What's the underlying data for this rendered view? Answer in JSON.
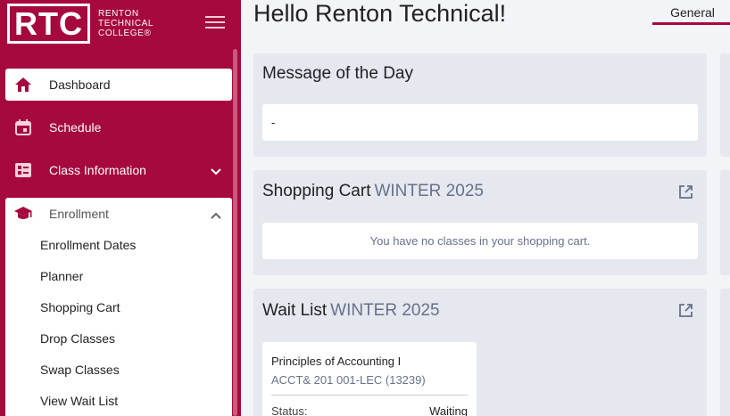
{
  "logo": {
    "abbr": "RTC",
    "line1": "RENTON",
    "line2": "TECHNICAL",
    "line3": "COLLEGE®"
  },
  "sidebar": {
    "items": [
      {
        "label": "Dashboard",
        "icon": "home-icon"
      },
      {
        "label": "Schedule",
        "icon": "calendar-icon"
      },
      {
        "label": "Class Information",
        "icon": "class-info-icon"
      }
    ],
    "enrollment": {
      "label": "Enrollment",
      "icon": "graduation-cap-icon",
      "subitems": [
        "Enrollment Dates",
        "Planner",
        "Shopping Cart",
        "Drop Classes",
        "Swap Classes",
        "View Wait List"
      ]
    }
  },
  "header": {
    "title": "Hello Renton Technical!",
    "tab": "General"
  },
  "message_card": {
    "title": "Message of the Day",
    "body": "-"
  },
  "cart_card": {
    "title": "Shopping Cart",
    "term": "WINTER 2025",
    "empty_text": "You have no classes in your shopping cart."
  },
  "waitlist_card": {
    "title": "Wait List",
    "term": "WINTER 2025",
    "course_name": "Principles of Accounting I",
    "course_code": "ACCT& 201 001-LEC (13239)",
    "status_label": "Status:",
    "status_value": "Waiting"
  },
  "colors": {
    "brand": "#a6093d",
    "muted_text": "#67718a",
    "card_bg": "#e6e8f0"
  }
}
